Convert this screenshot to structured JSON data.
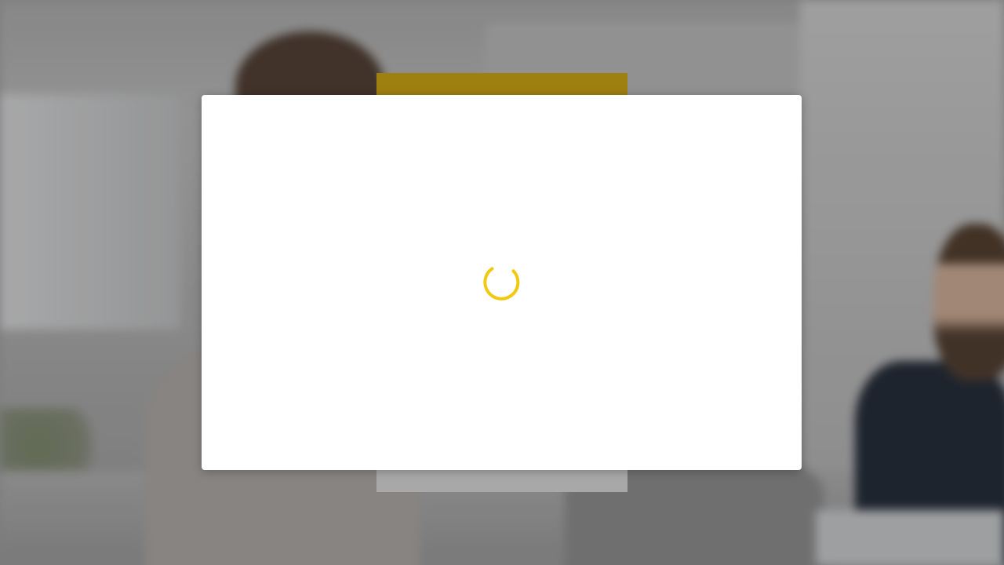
{
  "modal": {
    "state": "loading",
    "spinner_icon": "loading-spinner-icon",
    "spinner_color": "#f2c811"
  },
  "background": {
    "description_icon": "office-photo-background",
    "header_color": "#9e8010"
  }
}
